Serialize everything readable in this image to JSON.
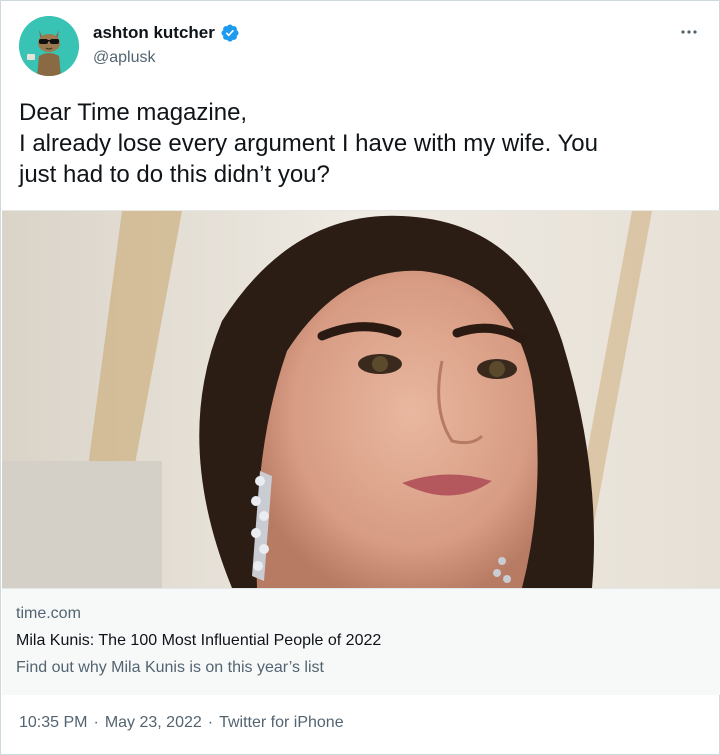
{
  "author": {
    "display_name": "ashton kutcher",
    "handle": "@aplusk",
    "avatar_icon": "sunglasses-cat-avatar",
    "avatar_bg": "#39c3b4",
    "verified_color": "#1d9bf0"
  },
  "menu_icon": "more-icon",
  "tweet": {
    "lines": [
      "Dear Time magazine,",
      "I already lose every argument I have with my wife. You",
      "just had to do this didn’t you?"
    ]
  },
  "card": {
    "domain": "time.com",
    "title": "Mila Kunis: The 100 Most Influential People of 2022",
    "description": "Find out why Mila Kunis is on this year’s list"
  },
  "footer": {
    "time": "10:35 PM",
    "separator": "·",
    "date": "May 23, 2022",
    "source": "Twitter for iPhone"
  }
}
